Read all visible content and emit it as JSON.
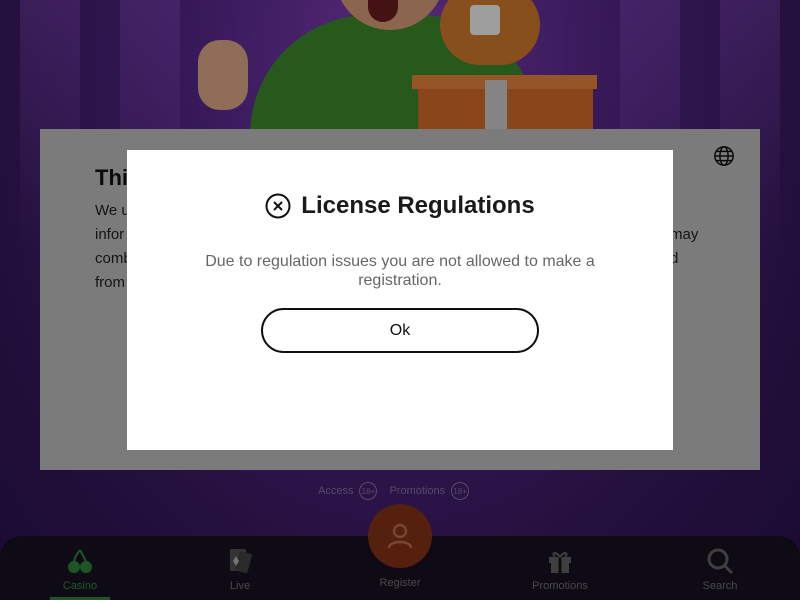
{
  "cookie_panel": {
    "title": "This",
    "text": "We u\ninfor\ncomb\nfrom",
    "text_right": "may\nd",
    "icon": "globe-icon"
  },
  "modal": {
    "title": "License Regulations",
    "message": "Due to regulation issues you are not allowed to make a registration.",
    "ok_label": "Ok",
    "icon": "close-circle-icon"
  },
  "footer_links": [
    {
      "label": "Access",
      "badge": "18+"
    },
    {
      "label": "Promotions",
      "badge": "18+"
    }
  ],
  "bottom_nav": {
    "items": [
      {
        "label": "Casino",
        "icon": "cherry-icon",
        "active": true
      },
      {
        "label": "Live",
        "icon": "playing-cards-icon",
        "active": false
      },
      {
        "label": "Register",
        "icon": "user-icon",
        "active": false
      },
      {
        "label": "Promotions",
        "icon": "gift-icon",
        "active": false
      },
      {
        "label": "Search",
        "icon": "search-icon",
        "active": false
      }
    ]
  },
  "colors": {
    "active_nav": "#2f8c3c",
    "register_button": "#8a3418",
    "nav_background": "#171221"
  }
}
